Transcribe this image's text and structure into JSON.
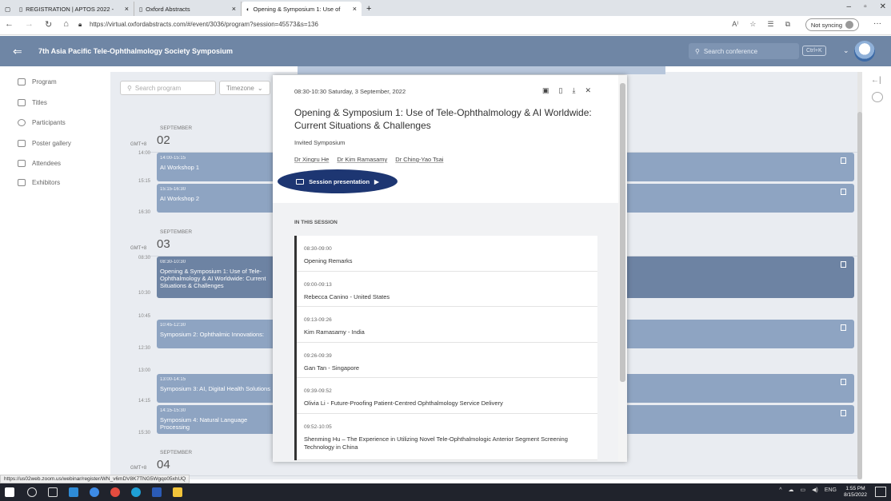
{
  "browser": {
    "tabs": [
      "REGISTRATION | APTOS 2022 - ",
      "Oxford Abstracts",
      "Opening & Symposium 1: Use of"
    ],
    "url": "https://virtual.oxfordabstracts.com/#/event/3036/program?session=45573&s=136",
    "sync": "Not syncing",
    "read_aloud": "A⁾"
  },
  "header": {
    "title": "7th Asia Pacific Tele-Ophthalmology Society Symposium",
    "search_placeholder": "Search conference",
    "shortcut": "Ctrl+K"
  },
  "sidebar": {
    "items": [
      "Program",
      "Titles",
      "Participants",
      "Poster gallery",
      "Attendees",
      "Exhibitors"
    ]
  },
  "program": {
    "search_placeholder": "Search program",
    "timezone": "Timezone",
    "days": [
      {
        "month": "SEPTEMBER",
        "gmt": "GMT+8",
        "day": "02"
      },
      {
        "month": "SEPTEMBER",
        "gmt": "GMT+8",
        "day": "03"
      },
      {
        "month": "SEPTEMBER",
        "gmt": "GMT+8",
        "day": "04"
      }
    ],
    "times": [
      "14:00",
      "15:15",
      "16:30",
      "08:30",
      "10:30",
      "10:45",
      "12:30",
      "13:00",
      "14:15",
      "15:30"
    ],
    "events": [
      {
        "time": "14:00-15:15",
        "name": "AI Workshop 1"
      },
      {
        "time": "15:15-16:30",
        "name": "AI Workshop 2"
      },
      {
        "time": "08:30-10:30",
        "name": "Opening & Symposium 1: Use of Tele-Ophthalmology & AI Worldwide: Current Situations & Challenges"
      },
      {
        "time": "10:45-12:30",
        "name": "Symposium 2: Ophthalmic Innovations:"
      },
      {
        "time": "13:00-14:15",
        "name": "Symposium 3: AI, Digital Health Solutions"
      },
      {
        "time": "14:15-15:30",
        "name": "Symposium 4: Natural Language Processing"
      }
    ]
  },
  "modal": {
    "datetime": "08:30-10:30 Saturday, 3 September, 2022",
    "title": "Opening & Symposium 1: Use of Tele-Ophthalmology & AI Worldwide: Current Situations & Challenges",
    "type": "Invited Symposium",
    "speakers": [
      "Dr Xingru He",
      "Dr Kim Ramasamy",
      "Dr Ching-Yao Tsai"
    ],
    "session_button": "Session presentation",
    "in_this_session": "IN THIS SESSION",
    "items": [
      {
        "time": "08:30-09:00",
        "name": "Opening Remarks"
      },
      {
        "time": "09:00-09:13",
        "name": "Rebecca Canino - United States"
      },
      {
        "time": "09:13-09:26",
        "name": "Kim Ramasamy - India"
      },
      {
        "time": "09:26-09:39",
        "name": "Gan Tan - Singapore"
      },
      {
        "time": "09:39-09:52",
        "name": "Olivia Li - Future-Proofing Patient-Centred Ophthalmology Service Delivery"
      },
      {
        "time": "09:52-10:05",
        "name": "Shenming Hu – The Experience in Utilizing Novel Tele-Ophthalmologic Anterior Segment Screening Technology in China"
      }
    ]
  },
  "statusbar": "https://us02web.zoom.us/webinar/register/WN_v6mDV8K7TNG5Wgqo05xhUQ",
  "taskbar": {
    "lang": "ENG",
    "time": "1:55 PM",
    "date": "8/15/2022"
  }
}
